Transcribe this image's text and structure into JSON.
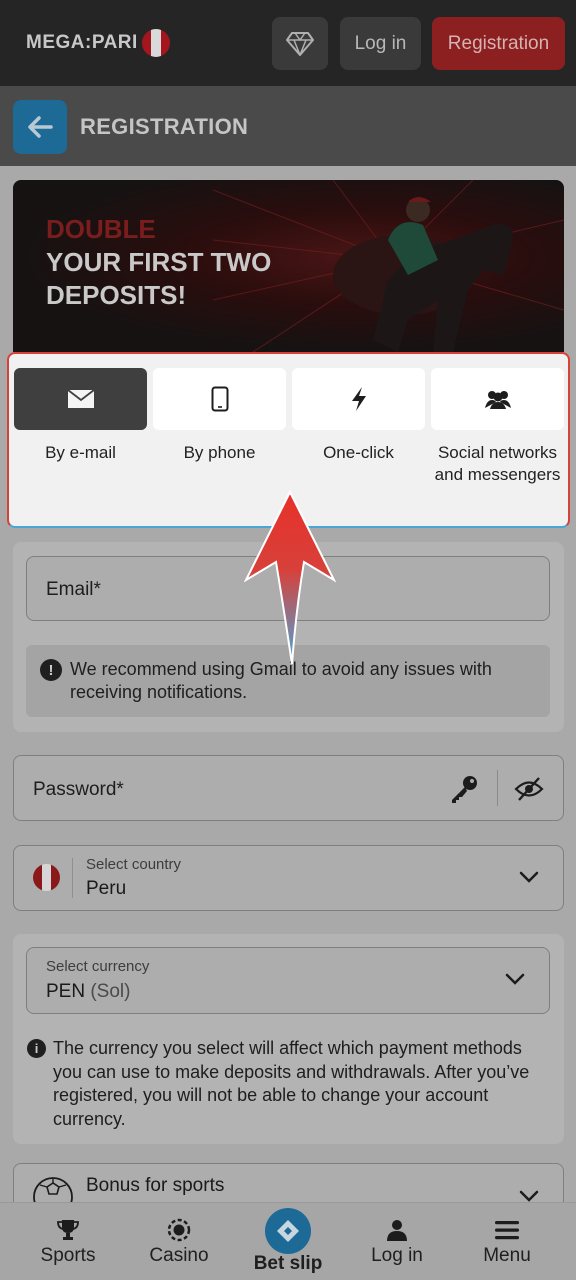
{
  "header": {
    "logo_text": "MEGA:PARI",
    "login_label": "Log in",
    "registration_label": "Registration"
  },
  "titlebar": {
    "title": "REGISTRATION"
  },
  "banner": {
    "line1": "DOUBLE",
    "line2": "YOUR FIRST TWO",
    "line3": "DEPOSITS!"
  },
  "methods": [
    {
      "label": "By e-mail",
      "icon": "envelope-icon",
      "active": true
    },
    {
      "label": "By phone",
      "icon": "phone-icon",
      "active": false
    },
    {
      "label": "One-click",
      "icon": "lightning-icon",
      "active": false
    },
    {
      "label": "Social networks and messengers",
      "icon": "users-icon",
      "active": false
    }
  ],
  "email": {
    "label": "Email*",
    "note": "We recommend using Gmail to avoid any issues with receiving notifications."
  },
  "password": {
    "label": "Password*"
  },
  "country": {
    "label": "Select country",
    "value": "Peru"
  },
  "currency": {
    "label": "Select currency",
    "code": "PEN",
    "name": "(Sol)",
    "note": "The currency you select will affect which payment methods you can use to make deposits and withdrawals. After you’ve registered, you will not be able to change your account currency."
  },
  "bonus": {
    "label": "Bonus for sports"
  },
  "bottom_nav": [
    {
      "label": "Sports",
      "icon": "trophy-icon"
    },
    {
      "label": "Casino",
      "icon": "casino-chip-icon"
    },
    {
      "label": "Bet slip",
      "icon": "ticket-icon"
    },
    {
      "label": "Log in",
      "icon": "user-icon"
    },
    {
      "label": "Menu",
      "icon": "menu-icon"
    }
  ],
  "colors": {
    "accent_blue": "#1d6a96",
    "registration_red": "#8c1f1f",
    "highlight_border": "#d8403a"
  }
}
